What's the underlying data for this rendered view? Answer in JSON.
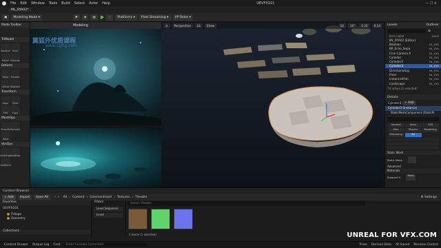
{
  "menu": {
    "items": [
      "File",
      "Edit",
      "Window",
      "Tools",
      "Build",
      "Select",
      "Actor",
      "Help"
    ],
    "app_title": "UEVFX101"
  },
  "title_tab": "ML_RYA02*",
  "toolbar": {
    "mode_label": "Modeling Mode",
    "platforms_label": "Platforms",
    "pixel_streaming_label": "Pixel Streaming",
    "vp_roles_label": "VP Roles"
  },
  "left_panel": {
    "mode_toolbar_label": "Mode Toolbar",
    "modeling_tab_label": "Modeling",
    "sections": [
      {
        "title": "TriModel",
        "tools": [
          "Boolean",
          "Inset",
          "Bevel",
          "Extrude"
        ]
      },
      {
        "title": "Deform",
        "tools": [
          "Warp",
          "Smooth",
          "Lattice",
          "Displace"
        ]
      },
      {
        "title": "Transform",
        "tools": [
          "Align",
          "Pivot",
          "Edit",
          "Copy"
        ]
      },
      {
        "title": "MeshOps",
        "tools": [
          "Simplify",
          "Remesh",
          "Weld"
        ]
      },
      {
        "title": "VoxOps",
        "tools": [
          "VoxMerge",
          "VoxWrap",
          "VoxBlend"
        ]
      }
    ]
  },
  "watermark": {
    "cn": "翼狐外优质课程",
    "url": "www.cgltg.com",
    "bottom": "UNREAL FOR VFX.COM"
  },
  "viewport": {
    "perspective_label": "Perspective",
    "lit_label": "Lit",
    "show_label": "Show",
    "grid_value": "10",
    "angle_value": "10°",
    "scale_value": "0.25",
    "camera_value": "0.14"
  },
  "outliner": {
    "tabs": [
      "Levels",
      "Outliner"
    ],
    "column_label": "Item Label",
    "column_level": "Level",
    "rows": [
      {
        "label": "ML_RYA02 (Editor)",
        "level": "",
        "selected": false
      },
      {
        "label": "Boolean",
        "level": "ML_RYA",
        "selected": false
      },
      {
        "label": "BP_Echo_Sepa",
        "level": "ML_RYA",
        "selected": false
      },
      {
        "label": "Cine Camera A",
        "level": "ML_RYA",
        "selected": false
      },
      {
        "label": "Cylinder",
        "level": "ML_RYA",
        "selected": false
      },
      {
        "label": "Cylinder2",
        "level": "ML_RYA",
        "selected": false
      },
      {
        "label": "Cylinder3",
        "level": "ML_RYA",
        "selected": true
      },
      {
        "label": "DirectionalLig",
        "level": "ML_RYA",
        "selected": false
      },
      {
        "label": "Floor",
        "level": "ML_RYA",
        "selected": false
      },
      {
        "label": "InstancedFoli",
        "level": "ML_RYA",
        "selected": false
      },
      {
        "label": "Landscape",
        "level": "ML_RYA",
        "selected": false
      }
    ],
    "count_text": "74 actors (1 selected)"
  },
  "details": {
    "title": "Details",
    "actor_name": "Cylinder3",
    "add_label": "+ Add",
    "instance_label": "Cylinder3 (Instance)",
    "component_label": "StaticMeshComponent (StaticM",
    "filter_tabs": [
      "General",
      "Actor",
      "LOD",
      "Misc",
      "Physics",
      "Rendering",
      "Streaming",
      "All"
    ],
    "sections": [
      "Static Mesh",
      "Advanced",
      "Materials"
    ],
    "static_mesh_label": "Static Mesh",
    "element_label": "Element 0",
    "element_value": "Mesh"
  },
  "content_browser": {
    "tab_label": "Content Browser",
    "add_label": "+ Add",
    "import_label": "Import",
    "save_all_label": "Save All",
    "breadcrumb": [
      "All",
      "Content",
      "CommonHazel",
      "Textures",
      "Tileable"
    ],
    "settings_label": "Settings",
    "favorites_label": "Favorites",
    "project_label": "UEVFX101",
    "tree": [
      "Foliage",
      "Geometry"
    ],
    "collections_label": "Collections",
    "filters_label": "Filters",
    "filter_items": [
      "Level Sequence",
      "Level"
    ],
    "search_placeholder": "Search Tileable",
    "status": "3 items (1 selected)",
    "thumb_colors": [
      "#7a5c3a",
      "#5fd46a",
      "#6a72ee"
    ]
  },
  "statusbar": {
    "content_drawer": "Content Drawer",
    "output_log": "Output Log",
    "cmd": "Cmd",
    "cmd_placeholder": "Enter Console Command",
    "trace": "Trace",
    "derived_data": "Derived Data",
    "all_saved": "All Saved",
    "revision_control": "Revision Control"
  }
}
